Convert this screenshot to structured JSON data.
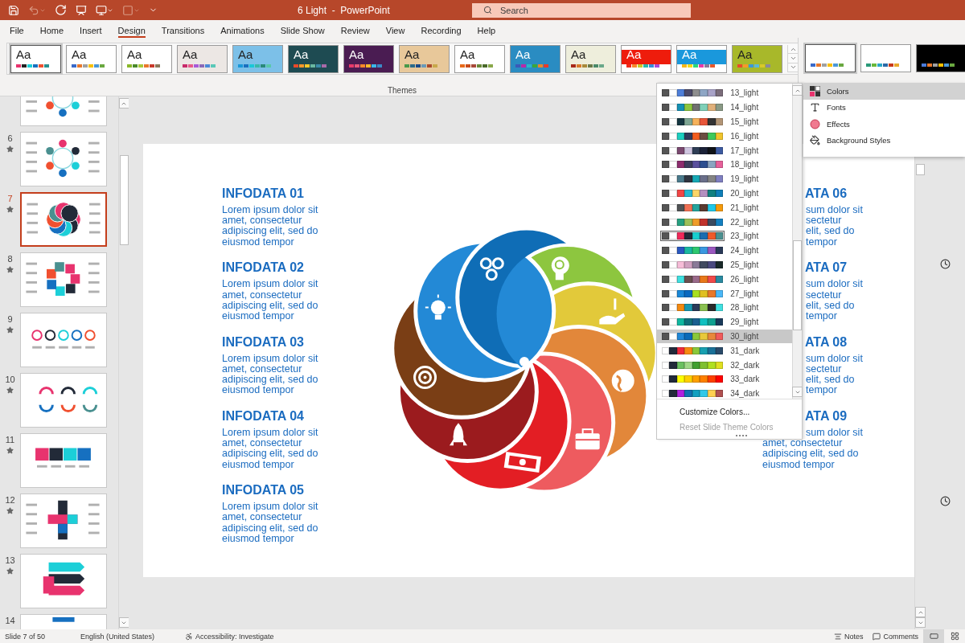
{
  "window": {
    "title": "6 Light  -  PowerPoint",
    "search": {
      "placeholder": "Search"
    }
  },
  "tabs": [
    {
      "label": "File",
      "selected": false
    },
    {
      "label": "Home",
      "selected": false
    },
    {
      "label": "Insert",
      "selected": false
    },
    {
      "label": "Design",
      "selected": true
    },
    {
      "label": "Transitions",
      "selected": false
    },
    {
      "label": "Animations",
      "selected": false
    },
    {
      "label": "Slide Show",
      "selected": false
    },
    {
      "label": "Review",
      "selected": false
    },
    {
      "label": "View",
      "selected": false
    },
    {
      "label": "Recording",
      "selected": false
    },
    {
      "label": "Help",
      "selected": false
    }
  ],
  "themes": {
    "label": "Themes",
    "items": [
      {
        "label": "Aa",
        "color": "#ffffff",
        "selected": true,
        "swatches": [
          {
            "color": "#e8336e"
          },
          {
            "color": "#222222"
          },
          {
            "color": "#1ccfd8"
          },
          {
            "color": "#1670c0"
          },
          {
            "color": "#f05030"
          },
          {
            "color": "#2a9090"
          }
        ]
      },
      {
        "label": "Aa",
        "color": "#ffffff",
        "selected": false,
        "swatches": [
          {
            "color": "#3a6ac8"
          },
          {
            "color": "#e8782a"
          },
          {
            "color": "#a0a0a0"
          },
          {
            "color": "#f8c000"
          },
          {
            "color": "#4a98d8"
          },
          {
            "color": "#6aa840"
          }
        ]
      },
      {
        "label": "Aa",
        "color": "#ffffff",
        "selected": false,
        "swatches": [
          {
            "color": "#8ab82a"
          },
          {
            "color": "#4a8a2a"
          },
          {
            "color": "#a8c83a"
          },
          {
            "color": "#e8782a"
          },
          {
            "color": "#c83a2a"
          },
          {
            "color": "#8a7a5a"
          }
        ]
      },
      {
        "label": "Aa",
        "color": "#ece7e4",
        "selected": false,
        "swatches": [
          {
            "color": "#c82a6a"
          },
          {
            "color": "#e85a8a"
          },
          {
            "color": "#a85ad8"
          },
          {
            "color": "#8a6ab8"
          },
          {
            "color": "#4a8ad8"
          },
          {
            "color": "#5ac8b8"
          }
        ]
      },
      {
        "label": "Aa",
        "color": "#7cc0e8",
        "selected": false,
        "swatches": [
          {
            "color": "#1a98d8"
          },
          {
            "color": "#1a70c0"
          },
          {
            "color": "#1ac8d8"
          },
          {
            "color": "#3ab8a8"
          },
          {
            "color": "#2a8a7a"
          },
          {
            "color": "#5ac8a8"
          }
        ]
      },
      {
        "label": "Aa",
        "color": "#1e4b52",
        "selected": false,
        "swatches": [
          {
            "color": "#e84a2a"
          },
          {
            "color": "#f8982a"
          },
          {
            "color": "#f8c82a"
          },
          {
            "color": "#6ab8a0"
          },
          {
            "color": "#3a8aa8"
          },
          {
            "color": "#a86aa8"
          }
        ]
      },
      {
        "label": "Aa",
        "color": "#4a1c52",
        "selected": false,
        "swatches": [
          {
            "color": "#e83a6a"
          },
          {
            "color": "#e8587a"
          },
          {
            "color": "#f8882a"
          },
          {
            "color": "#f8b82a"
          },
          {
            "color": "#3ab8e8"
          },
          {
            "color": "#3a8ac8"
          }
        ]
      },
      {
        "label": "Aa",
        "color": "#e8c89a",
        "selected": false,
        "swatches": [
          {
            "color": "#4a9a4a"
          },
          {
            "color": "#2a6a8a"
          },
          {
            "color": "#1a4a8a"
          },
          {
            "color": "#6a9ab8"
          },
          {
            "color": "#aa4a2a"
          },
          {
            "color": "#c8a84a"
          }
        ]
      },
      {
        "label": "Aa",
        "color": "#ffffff",
        "selected": false,
        "swatches": [
          {
            "color": "#e86a1a"
          },
          {
            "color": "#c84a1a"
          },
          {
            "color": "#a84a3a"
          },
          {
            "color": "#6a8a3a"
          },
          {
            "color": "#4a6a2a"
          },
          {
            "color": "#8aa84a"
          }
        ]
      },
      {
        "label": "Aa",
        "color": "#2a8cc2",
        "selected": false,
        "swatches": [
          {
            "color": "#3a5ab8"
          },
          {
            "color": "#b82aa8"
          },
          {
            "color": "#2ab8c8"
          },
          {
            "color": "#3aa83a"
          },
          {
            "color": "#e8882a"
          },
          {
            "color": "#e83a2a"
          }
        ]
      },
      {
        "label": "Aa",
        "color": "#eeeedc",
        "selected": false,
        "swatches": [
          {
            "color": "#a82a1a"
          },
          {
            "color": "#d87a2a"
          },
          {
            "color": "#a88a3a"
          },
          {
            "color": "#6a7a4a"
          },
          {
            "color": "#4a8a6a"
          },
          {
            "color": "#6aa88a"
          }
        ]
      },
      {
        "label": "Aa",
        "color": "#ffffff",
        "accent": {
          "color": "#ee1c0c"
        },
        "selected": false,
        "swatches": [
          {
            "color": "#f02a1a"
          },
          {
            "color": "#f8882a"
          },
          {
            "color": "#c8c82a"
          },
          {
            "color": "#2ab8a8"
          },
          {
            "color": "#3a8ad8"
          },
          {
            "color": "#a84ad8"
          }
        ]
      },
      {
        "label": "Aa",
        "color": "#ffffff",
        "accent": {
          "color": "#1a98dc"
        },
        "selected": false,
        "swatches": [
          {
            "color": "#f8b81a"
          },
          {
            "color": "#f8d81a"
          },
          {
            "color": "#2ad87a"
          },
          {
            "color": "#e83aa8"
          },
          {
            "color": "#8a7a9a"
          },
          {
            "color": "#e8582a"
          }
        ]
      },
      {
        "label": "Aa",
        "color": "#a8b82a",
        "selected": false,
        "swatches": [
          {
            "color": "#e84a2a"
          },
          {
            "color": "#f8982a"
          },
          {
            "color": "#3a98d8"
          },
          {
            "color": "#5ab8d8"
          },
          {
            "color": "#d8c82a"
          },
          {
            "color": "#8a8a9a"
          }
        ]
      }
    ]
  },
  "variants": [
    {
      "color": "#ffffff",
      "selected": true,
      "swatches": [
        {
          "color": "#3a6ac8"
        },
        {
          "color": "#e8782a"
        },
        {
          "color": "#a0a0a0"
        },
        {
          "color": "#f8c000"
        },
        {
          "color": "#4a98d8"
        },
        {
          "color": "#6aa840"
        }
      ]
    },
    {
      "color": "#ffffff",
      "selected": false,
      "swatches": [
        {
          "color": "#2a9a7a"
        },
        {
          "color": "#6ab83a"
        },
        {
          "color": "#2aa8c8"
        },
        {
          "color": "#2a6aa8"
        },
        {
          "color": "#c83a1a"
        },
        {
          "color": "#e8a82a"
        }
      ]
    },
    {
      "color": "#000000",
      "selected": false,
      "swatches": [
        {
          "color": "#4a7ad8"
        },
        {
          "color": "#e8782a"
        },
        {
          "color": "#a0a0a0"
        },
        {
          "color": "#f8c000"
        },
        {
          "color": "#4a98d8"
        },
        {
          "color": "#6aa840"
        }
      ]
    }
  ],
  "slides": [
    {
      "kind": "ring",
      "selected": false,
      "starred": false
    },
    {
      "number": "6",
      "kind": "ring",
      "selected": false,
      "starred": true
    },
    {
      "number": "7",
      "kind": "spiral",
      "selected": true,
      "starred": true
    },
    {
      "number": "8",
      "kind": "flower",
      "selected": false,
      "starred": true
    },
    {
      "number": "9",
      "kind": "row",
      "selected": false,
      "starred": true
    },
    {
      "number": "10",
      "kind": "arcs",
      "selected": false,
      "starred": true
    },
    {
      "number": "11",
      "kind": "puzzle",
      "selected": false,
      "starred": true
    },
    {
      "number": "12",
      "kind": "cross",
      "selected": false,
      "starred": true
    },
    {
      "number": "13",
      "kind": "arrows",
      "selected": false,
      "starred": true
    },
    {
      "number": "14",
      "kind": "banner",
      "selected": false,
      "starred": false
    }
  ],
  "slide": {
    "left": [
      {
        "title": "INFODATA 01",
        "lines": [
          "Lorem ipsum dolor sit",
          "amet, consectetur",
          "adipiscing elit, sed do",
          "eiusmod tempor"
        ]
      },
      {
        "title": "INFODATA 02",
        "lines": [
          "Lorem ipsum dolor sit",
          "amet, consectetur",
          "adipiscing elit, sed do",
          "eiusmod tempor"
        ]
      },
      {
        "title": "INFODATA 03",
        "lines": [
          "Lorem ipsum dolor sit",
          "amet, consectetur",
          "adipiscing elit, sed do",
          "eiusmod tempor"
        ]
      },
      {
        "title": "INFODATA 04",
        "lines": [
          "Lorem ipsum dolor sit",
          "amet, consectetur",
          "adipiscing elit, sed do",
          "eiusmod tempor"
        ]
      },
      {
        "title": "INFODATA 05",
        "lines": [
          "Lorem ipsum dolor sit",
          "amet, consectetur",
          "adipiscing elit, sed do",
          "eiusmod tempor"
        ]
      }
    ],
    "right": [
      {
        "title": "ATA 06",
        "lines": [
          {
            "text": "sum dolor sit",
            "cut": true
          },
          {
            "text": "sectetur",
            "cut": true
          },
          {
            "text": "elit, sed do",
            "cut": true
          },
          {
            "text": "tempor",
            "cut": true
          }
        ]
      },
      {
        "title": "ATA 07",
        "lines": [
          {
            "text": "sum dolor sit",
            "cut": true
          },
          {
            "text": "sectetur",
            "cut": true
          },
          {
            "text": "elit, sed do",
            "cut": true
          },
          {
            "text": "tempor",
            "cut": true
          }
        ]
      },
      {
        "title": "ATA 08",
        "lines": [
          {
            "text": "sum dolor sit",
            "cut": true
          },
          {
            "text": "sectetur",
            "cut": true
          },
          {
            "text": "elit, sed do",
            "cut": true
          },
          {
            "text": "tempor",
            "cut": true
          }
        ]
      },
      {
        "title": "ATA 09",
        "lines": [
          {
            "text": "sum dolor sit",
            "cut": true
          },
          {
            "text": "amet, consectetur",
            "cut": false
          },
          {
            "text": "adipiscing elit, sed do",
            "cut": false
          },
          {
            "text": "eiusmod tempor",
            "cut": false
          }
        ]
      }
    ]
  },
  "colors_menu": {
    "items": [
      {
        "label": "13_light",
        "selected": false,
        "current": false,
        "swatches": [
          {
            "color": "#555555"
          },
          {
            "color": "#ffffff"
          },
          {
            "color": "#4f7fd9"
          },
          {
            "color": "#4c4a6a"
          },
          {
            "color": "#8e8e8e"
          },
          {
            "color": "#8ea6c5"
          },
          {
            "color": "#a9a3c8"
          },
          {
            "color": "#7b6d7b"
          }
        ]
      },
      {
        "label": "14_light",
        "selected": false,
        "current": false,
        "swatches": [
          {
            "color": "#555555"
          },
          {
            "color": "#ffffff"
          },
          {
            "color": "#1491b5"
          },
          {
            "color": "#8dc63f"
          },
          {
            "color": "#707070"
          },
          {
            "color": "#7fd0b8"
          },
          {
            "color": "#e0b07a"
          },
          {
            "color": "#8a9a86"
          }
        ]
      },
      {
        "label": "15_light",
        "selected": false,
        "current": false,
        "swatches": [
          {
            "color": "#555555"
          },
          {
            "color": "#ffffff"
          },
          {
            "color": "#153641"
          },
          {
            "color": "#7ea694"
          },
          {
            "color": "#f6b15a"
          },
          {
            "color": "#e8563a"
          },
          {
            "color": "#333333"
          },
          {
            "color": "#b29576"
          }
        ]
      },
      {
        "label": "16_light",
        "selected": false,
        "current": false,
        "swatches": [
          {
            "color": "#555555"
          },
          {
            "color": "#ffffff"
          },
          {
            "color": "#1ccfc0"
          },
          {
            "color": "#2f3a5a"
          },
          {
            "color": "#f25c1e"
          },
          {
            "color": "#6b4d42"
          },
          {
            "color": "#3ec95a"
          },
          {
            "color": "#f0c42c"
          }
        ]
      },
      {
        "label": "17_light",
        "selected": false,
        "current": false,
        "swatches": [
          {
            "color": "#555555"
          },
          {
            "color": "#ffffff"
          },
          {
            "color": "#7a4970"
          },
          {
            "color": "#cfc5e0"
          },
          {
            "color": "#2e3d55"
          },
          {
            "color": "#1b2238"
          },
          {
            "color": "#0f1318"
          },
          {
            "color": "#3c5aa0"
          }
        ]
      },
      {
        "label": "18_light",
        "selected": false,
        "current": false,
        "swatches": [
          {
            "color": "#555555"
          },
          {
            "color": "#ffffff"
          },
          {
            "color": "#8d2c6e"
          },
          {
            "color": "#3c3c5c"
          },
          {
            "color": "#5a4f9d"
          },
          {
            "color": "#2c4e90"
          },
          {
            "color": "#8aa4c0"
          },
          {
            "color": "#e6609a"
          }
        ]
      },
      {
        "label": "19_light",
        "selected": false,
        "current": false,
        "swatches": [
          {
            "color": "#555555"
          },
          {
            "color": "#ffffff"
          },
          {
            "color": "#4a7a8c"
          },
          {
            "color": "#2f3540"
          },
          {
            "color": "#17a9b5"
          },
          {
            "color": "#6a6f8a"
          },
          {
            "color": "#848484"
          },
          {
            "color": "#7f7fc0"
          }
        ]
      },
      {
        "label": "20_light",
        "selected": false,
        "current": false,
        "swatches": [
          {
            "color": "#555555"
          },
          {
            "color": "#ffffff"
          },
          {
            "color": "#f24646"
          },
          {
            "color": "#27b7cf"
          },
          {
            "color": "#fcd667"
          },
          {
            "color": "#b490c0"
          },
          {
            "color": "#108080"
          },
          {
            "color": "#0f7fb8"
          }
        ]
      },
      {
        "label": "21_light",
        "selected": false,
        "current": false,
        "swatches": [
          {
            "color": "#555555"
          },
          {
            "color": "#ffffff"
          },
          {
            "color": "#505355"
          },
          {
            "color": "#f07054"
          },
          {
            "color": "#25a39c"
          },
          {
            "color": "#5a3a30"
          },
          {
            "color": "#1ec8e8"
          },
          {
            "color": "#f59a0a"
          }
        ]
      },
      {
        "label": "22_light",
        "selected": false,
        "current": false,
        "swatches": [
          {
            "color": "#555555"
          },
          {
            "color": "#ffffff"
          },
          {
            "color": "#26a080"
          },
          {
            "color": "#9dc05a"
          },
          {
            "color": "#f09c28"
          },
          {
            "color": "#c0322c"
          },
          {
            "color": "#3a4a60"
          },
          {
            "color": "#1480c0"
          }
        ]
      },
      {
        "label": "23_light",
        "selected": false,
        "current": true,
        "swatches": [
          {
            "color": "#555555"
          },
          {
            "color": "#ffffff"
          },
          {
            "color": "#f02a5a"
          },
          {
            "color": "#222a38"
          },
          {
            "color": "#18d0d0"
          },
          {
            "color": "#1a6cb0"
          },
          {
            "color": "#f05a2a"
          },
          {
            "color": "#4a9090"
          }
        ]
      },
      {
        "label": "24_light",
        "selected": false,
        "current": false,
        "swatches": [
          {
            "color": "#555555"
          },
          {
            "color": "#ffffff"
          },
          {
            "color": "#2a58c0"
          },
          {
            "color": "#1ab8a0"
          },
          {
            "color": "#2ec870"
          },
          {
            "color": "#3a98e0"
          },
          {
            "color": "#9a58c0"
          },
          {
            "color": "#2a3a58"
          }
        ]
      },
      {
        "label": "25_light",
        "selected": false,
        "current": false,
        "swatches": [
          {
            "color": "#555555"
          },
          {
            "color": "#ffffff"
          },
          {
            "color": "#f6bcd8"
          },
          {
            "color": "#d0a0c0"
          },
          {
            "color": "#8a7a98"
          },
          {
            "color": "#404a60"
          },
          {
            "color": "#4a4a80"
          },
          {
            "color": "#1a2a2a"
          }
        ]
      },
      {
        "label": "26_light",
        "selected": false,
        "current": false,
        "swatches": [
          {
            "color": "#555555"
          },
          {
            "color": "#ffffff"
          },
          {
            "color": "#40e0e0"
          },
          {
            "color": "#6a5050"
          },
          {
            "color": "#9a6a8a"
          },
          {
            "color": "#e8781a"
          },
          {
            "color": "#f04a4a"
          },
          {
            "color": "#2a8aa0"
          }
        ]
      },
      {
        "label": "27_light",
        "selected": false,
        "current": false,
        "swatches": [
          {
            "color": "#555555"
          },
          {
            "color": "#ffffff"
          },
          {
            "color": "#1a88d8"
          },
          {
            "color": "#0a6ac0"
          },
          {
            "color": "#a8e020"
          },
          {
            "color": "#e0c020"
          },
          {
            "color": "#e8782a"
          },
          {
            "color": "#4ab8f8"
          }
        ]
      },
      {
        "label": "28_light",
        "selected": false,
        "current": false,
        "swatches": [
          {
            "color": "#555555"
          },
          {
            "color": "#ffffff"
          },
          {
            "color": "#f58a10"
          },
          {
            "color": "#1a98b0"
          },
          {
            "color": "#2a3a58"
          },
          {
            "color": "#8ac050"
          },
          {
            "color": "#2a2a2a"
          },
          {
            "color": "#40e0e0"
          }
        ]
      },
      {
        "label": "29_light",
        "selected": false,
        "current": false,
        "swatches": [
          {
            "color": "#555555"
          },
          {
            "color": "#ffffff"
          },
          {
            "color": "#10b8a0"
          },
          {
            "color": "#10707a"
          },
          {
            "color": "#1a6090"
          },
          {
            "color": "#10c0c0"
          },
          {
            "color": "#10a090"
          },
          {
            "color": "#1a3a5a"
          }
        ]
      },
      {
        "label": "30_light",
        "selected": true,
        "current": false,
        "swatches": [
          {
            "color": "#555555"
          },
          {
            "color": "#ffffff"
          },
          {
            "color": "#2088d8"
          },
          {
            "color": "#0a6ab8"
          },
          {
            "color": "#8ac83a"
          },
          {
            "color": "#e8c83a"
          },
          {
            "color": "#e8883a"
          },
          {
            "color": "#f05a5a"
          }
        ]
      },
      {
        "label": "31_dark",
        "selected": false,
        "current": false,
        "swatches": [
          {
            "color": "#ffffff"
          },
          {
            "color": "#222a3a"
          },
          {
            "color": "#f02a3a"
          },
          {
            "color": "#f88a10"
          },
          {
            "color": "#8ac83a"
          },
          {
            "color": "#18a0b0"
          },
          {
            "color": "#1a7098"
          },
          {
            "color": "#2a4a6a"
          }
        ]
      },
      {
        "label": "32_dark",
        "selected": false,
        "current": false,
        "swatches": [
          {
            "color": "#ffffff"
          },
          {
            "color": "#222a3a"
          },
          {
            "color": "#6ac060"
          },
          {
            "color": "#a0d888"
          },
          {
            "color": "#40a030"
          },
          {
            "color": "#80c030"
          },
          {
            "color": "#b0e020"
          },
          {
            "color": "#e0e020"
          }
        ]
      },
      {
        "label": "33_dark",
        "selected": false,
        "current": false,
        "swatches": [
          {
            "color": "#ffffff"
          },
          {
            "color": "#222a3a"
          },
          {
            "color": "#ffff00"
          },
          {
            "color": "#ffd000"
          },
          {
            "color": "#ffa000"
          },
          {
            "color": "#ff8000"
          },
          {
            "color": "#ff4000"
          },
          {
            "color": "#ff0000"
          }
        ]
      },
      {
        "label": "34_dark",
        "selected": false,
        "current": false,
        "swatches": [
          {
            "color": "#ffffff"
          },
          {
            "color": "#222a3a"
          },
          {
            "color": "#b020e0"
          },
          {
            "color": "#1070b0"
          },
          {
            "color": "#10a0c0"
          },
          {
            "color": "#30c8e8"
          },
          {
            "color": "#ffd050"
          },
          {
            "color": "#b05050"
          }
        ]
      }
    ],
    "actions": [
      {
        "label": "Customize Colors...",
        "disabled": false
      },
      {
        "label": "Reset Slide Theme Colors",
        "disabled": true
      }
    ]
  },
  "variant_menu": [
    {
      "label": "Colors",
      "kind": "colors",
      "selected": true
    },
    {
      "label": "Fonts",
      "kind": "fonts",
      "selected": false
    },
    {
      "label": "Effects",
      "kind": "effects",
      "selected": false
    },
    {
      "label": "Background Styles",
      "kind": "background",
      "selected": false
    }
  ],
  "status_bar": {
    "slide": "Slide 7 of 50",
    "language": "English (United States)",
    "accessibility": "Accessibility: Investigate",
    "notes": "Notes",
    "comments": "Comments"
  }
}
